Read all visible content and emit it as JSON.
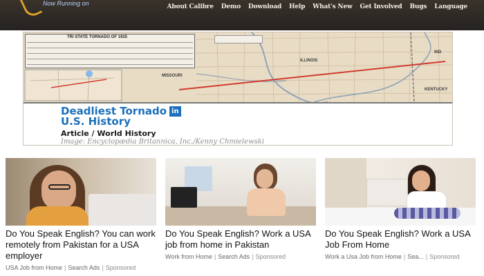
{
  "header": {
    "logo_tagline": "Now Running on",
    "nav": [
      "About Calibre",
      "Demo",
      "Download",
      "Help",
      "What's New",
      "Get Involved",
      "Bugs",
      "Language"
    ]
  },
  "hero": {
    "table_title": "TRI STATE TORNADO OF 1925",
    "map_labels": {
      "missouri": "MISSOURI",
      "illinois": "ILLINOIS",
      "indiana": "IND",
      "kentucky": "KENTUCKY"
    },
    "title": "Deadliest Tornado",
    "title_line2": "U.S. History",
    "title_badge": "in",
    "subtitle": "Article / World History",
    "credit": "Image: Encyclopædia Britannica, Inc./Kenny Chmielewski"
  },
  "ads": [
    {
      "title": "Do You Speak English? You can work remotely from Pakistan for a USA employer",
      "source": "USA Job from Home",
      "category": "Search Ads",
      "sponsored": "Sponsored"
    },
    {
      "title": "Do You Speak English? Work a USA job from home in Pakistan",
      "source": "Work from Home",
      "category": "Search Ads",
      "sponsored": "Sponsored"
    },
    {
      "title": "Do You Speak English? Work a USA Job From Home",
      "source": "Work a Usa Job from Home",
      "category": "Sea...",
      "sponsored": "Sponsored"
    }
  ],
  "colors": {
    "header_bg": "#2e2925",
    "nav_text": "#f2ede6",
    "headline_blue": "#1b6fbb",
    "logo_gold": "#d9a326",
    "tornado_path": "#d23a2e"
  }
}
